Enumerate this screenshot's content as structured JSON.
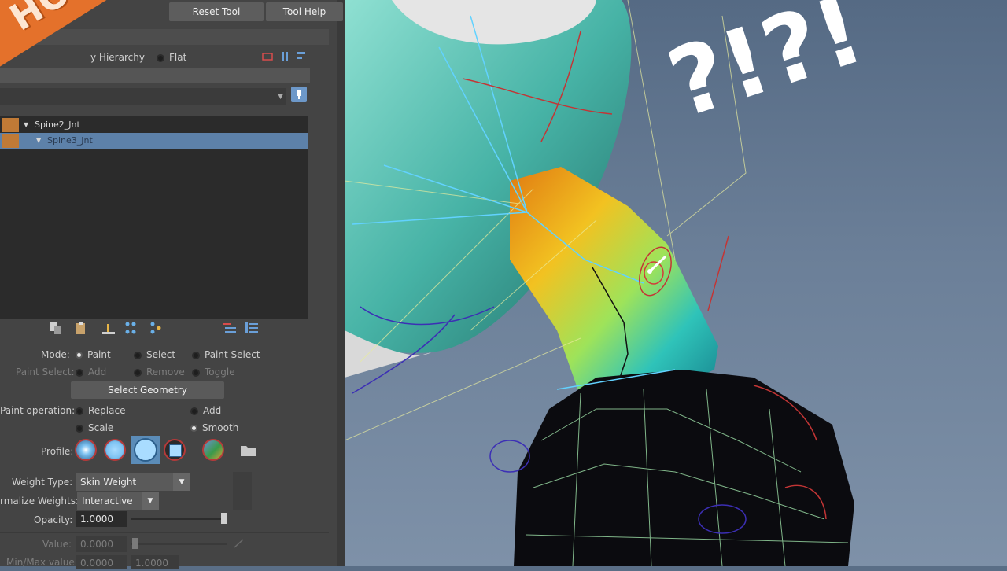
{
  "toolbar": {
    "reset_tool": "Reset Tool",
    "tool_help": "Tool Help"
  },
  "banner": {
    "text": "HOW to"
  },
  "influences": {
    "by_hierarchy": "y Hierarchy",
    "flat": "Flat"
  },
  "joints": [
    {
      "name": "Spine2_Jnt",
      "selected": false
    },
    {
      "name": "Spine3_Jnt",
      "selected": true
    }
  ],
  "mode": {
    "label": "Mode:",
    "paint": "Paint",
    "select": "Select",
    "paint_select": "Paint Select"
  },
  "paint_select": {
    "label": "Paint Select:",
    "add": "Add",
    "remove": "Remove",
    "toggle": "Toggle"
  },
  "select_geometry": "Select Geometry",
  "paint_operation": {
    "label": "Paint operation:",
    "replace": "Replace",
    "add": "Add",
    "scale": "Scale",
    "smooth": "Smooth"
  },
  "profile": {
    "label": "Profile:"
  },
  "weight_type": {
    "label": "Weight Type:",
    "value": "Skin Weight"
  },
  "normalize_weights": {
    "label": "rmalize Weights:",
    "value": "Interactive"
  },
  "opacity": {
    "label": "Opacity:",
    "value": "1.0000",
    "level": 1.0
  },
  "value": {
    "label": "Value:",
    "value": "0.0000",
    "level": 0.0
  },
  "minmax": {
    "label": "Min/Max value:",
    "min": "0.0000",
    "max": "1.0000"
  },
  "overlay": {
    "question": "?!?!"
  },
  "colors": {
    "accent": "#e4712b",
    "selected_row": "#5d81a9",
    "joint_swatch": "#c07a36"
  }
}
